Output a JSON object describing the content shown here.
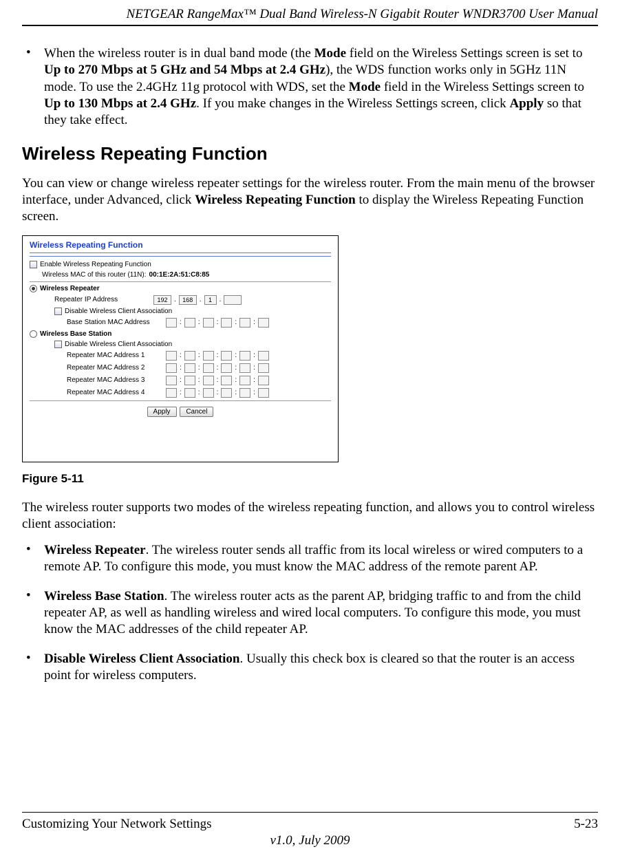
{
  "header": {
    "title": "NETGEAR RangeMax™ Dual Band Wireless-N Gigabit Router WNDR3700 User Manual"
  },
  "intro_bullet": {
    "pre": "When the wireless router is in dual band mode (the ",
    "b1": "Mode",
    "mid1": " field on the Wireless Settings screen is set to ",
    "b2": "Up to 270 Mbps at 5 GHz and 54 Mbps at 2.4 GHz",
    "mid2": "), the WDS function works only in 5GHz 11N mode. To use the 2.4GHz 11g protocol with WDS, set the ",
    "b3": "Mode",
    "mid3": " field in the Wireless Settings screen to ",
    "b4": "Up to 130 Mbps at 2.4 GHz",
    "mid4": ". If you make changes in the Wireless Settings screen, click ",
    "b5": "Apply",
    "post": " so that they take effect."
  },
  "section_title": "Wireless Repeating Function",
  "section_para": {
    "pre": "You can view or change wireless repeater settings for the wireless router. From the main menu of the browser interface, under Advanced, click ",
    "b1": "Wireless Repeating Function",
    "post": " to display the Wireless Repeating Function screen."
  },
  "figure": {
    "title": "Wireless Repeating Function",
    "enable_label": "Enable Wireless Repeating Function",
    "mac_line_pre": "Wireless MAC of this router (11N): ",
    "mac_value": "00:1E:2A:51:C8:85",
    "repeater_label": "Wireless Repeater",
    "repeater_ip_label": "Repeater IP Address",
    "ip": [
      "192",
      "168",
      "1",
      ""
    ],
    "disable_assoc_label": "Disable Wireless Client Association",
    "base_mac_label": "Base Station MAC Address",
    "base_station_label": "Wireless Base Station",
    "disable_assoc2_label": "Disable Wireless Client Association",
    "rep_mac_labels": [
      "Repeater MAC Address 1",
      "Repeater MAC Address 2",
      "Repeater MAC Address 3",
      "Repeater MAC Address 4"
    ],
    "apply": "Apply",
    "cancel": "Cancel"
  },
  "figure_caption": "Figure 5-11",
  "after_para": "The wireless router supports two modes of the wireless repeating function, and allows you to control wireless client association:",
  "bullets": [
    {
      "b": "Wireless Repeater",
      "text": ". The wireless router sends all traffic from its local wireless or wired computers to a remote AP. To configure this mode, you must know the MAC address of the remote parent AP."
    },
    {
      "b": "Wireless Base Station",
      "text": ". The wireless router acts as the parent AP, bridging traffic to and from the child repeater AP, as well as handling wireless and wired local computers. To configure this mode, you must know the MAC addresses of the child repeater AP."
    },
    {
      "b": "Disable Wireless Client Association",
      "text": ". Usually this check box is cleared so that the router is an access point for wireless computers."
    }
  ],
  "footer": {
    "left": "Customizing Your Network Settings",
    "right": "5-23",
    "version": "v1.0, July 2009"
  }
}
